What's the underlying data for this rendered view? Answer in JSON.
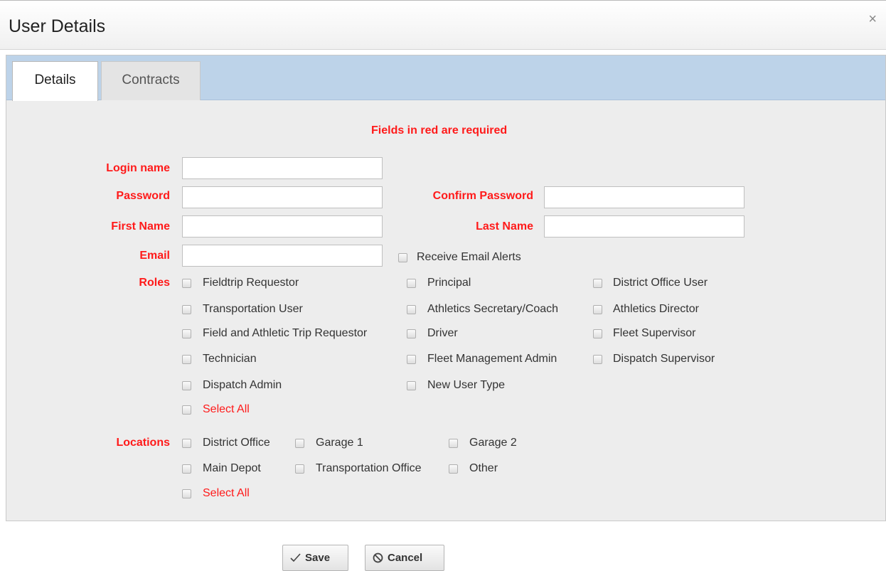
{
  "dialog": {
    "title": "User Details",
    "close_glyph": "×"
  },
  "tabs": [
    {
      "label": "Details"
    },
    {
      "label": "Contracts"
    }
  ],
  "form": {
    "required_note": "Fields in red are required",
    "login_label": "Login name",
    "password_label": "Password",
    "confirm_password_label": "Confirm Password",
    "first_name_label": "First Name",
    "last_name_label": "Last Name",
    "email_label": "Email",
    "receive_alerts_label": "Receive Email Alerts",
    "values": {
      "login": "",
      "password": "",
      "confirm_password": "",
      "first_name": "",
      "last_name": "",
      "email": ""
    }
  },
  "roles": {
    "label": "Roles",
    "items": [
      "Fieldtrip Requestor",
      "Principal",
      "District Office User",
      "Transportation User",
      "Athletics Secretary/Coach",
      "Athletics Director",
      "Field and Athletic Trip Requestor",
      "Driver",
      "Fleet Supervisor",
      "Technician",
      "Fleet Management Admin",
      "Dispatch Supervisor",
      "Dispatch Admin",
      "New User Type"
    ],
    "select_all": "Select All"
  },
  "locations": {
    "label": "Locations",
    "items": [
      "District Office",
      "Garage 1",
      "Garage 2",
      "Main Depot",
      "Transportation Office",
      "Other"
    ],
    "select_all": "Select All"
  },
  "buttons": {
    "save": "Save",
    "cancel": "Cancel"
  },
  "icons": {
    "close": "close-icon",
    "save": "checkmark-icon",
    "cancel": "cancel-circle-icon"
  },
  "colors": {
    "required": "#ff1a1a",
    "tabbar": "#bdd3e9",
    "panel": "#ededed"
  }
}
